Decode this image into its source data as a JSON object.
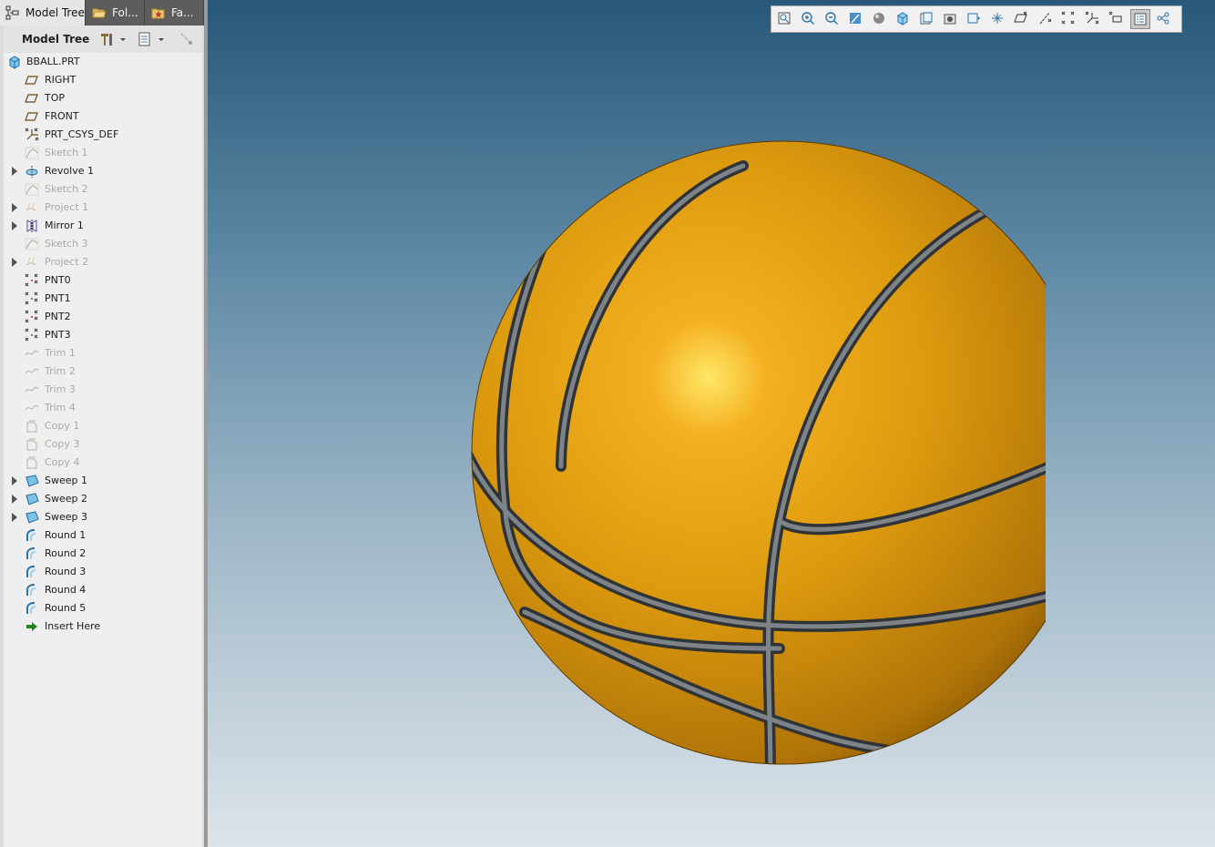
{
  "tabs": [
    {
      "label": "Model Tree",
      "icon": "model-tree-icon"
    },
    {
      "label": "Fol...",
      "icon": "folder-browser-icon"
    },
    {
      "label": "Fa...",
      "icon": "favorites-icon"
    }
  ],
  "tree_header": {
    "title": "Model Tree"
  },
  "tree": {
    "root": "BBALL.PRT",
    "items": [
      {
        "label": "RIGHT",
        "icon": "datum-plane-icon",
        "suppressed": false,
        "expandable": false
      },
      {
        "label": "TOP",
        "icon": "datum-plane-icon",
        "suppressed": false,
        "expandable": false
      },
      {
        "label": "FRONT",
        "icon": "datum-plane-icon",
        "suppressed": false,
        "expandable": false
      },
      {
        "label": "PRT_CSYS_DEF",
        "icon": "coordinate-system-icon",
        "suppressed": false,
        "expandable": false
      },
      {
        "label": "Sketch 1",
        "icon": "sketch-icon",
        "suppressed": true,
        "expandable": false
      },
      {
        "label": "Revolve 1",
        "icon": "revolve-icon",
        "suppressed": false,
        "expandable": true
      },
      {
        "label": "Sketch 2",
        "icon": "sketch-icon",
        "suppressed": true,
        "expandable": false
      },
      {
        "label": "Project 1",
        "icon": "project-icon",
        "suppressed": true,
        "expandable": true
      },
      {
        "label": "Mirror 1",
        "icon": "mirror-icon",
        "suppressed": false,
        "expandable": true
      },
      {
        "label": "Sketch 3",
        "icon": "sketch-icon",
        "suppressed": true,
        "expandable": false
      },
      {
        "label": "Project 2",
        "icon": "project-icon",
        "suppressed": true,
        "expandable": true
      },
      {
        "label": "PNT0",
        "icon": "datum-point-icon",
        "suppressed": false,
        "expandable": false
      },
      {
        "label": "PNT1",
        "icon": "datum-point-icon",
        "suppressed": false,
        "expandable": false
      },
      {
        "label": "PNT2",
        "icon": "datum-point-icon",
        "suppressed": false,
        "expandable": false
      },
      {
        "label": "PNT3",
        "icon": "datum-point-icon",
        "suppressed": false,
        "expandable": false
      },
      {
        "label": "Trim 1",
        "icon": "trim-icon",
        "suppressed": true,
        "expandable": false
      },
      {
        "label": "Trim 2",
        "icon": "trim-icon",
        "suppressed": true,
        "expandable": false
      },
      {
        "label": "Trim 3",
        "icon": "trim-icon",
        "suppressed": true,
        "expandable": false
      },
      {
        "label": "Trim 4",
        "icon": "trim-icon",
        "suppressed": true,
        "expandable": false
      },
      {
        "label": "Copy 1",
        "icon": "copy-icon",
        "suppressed": true,
        "expandable": false
      },
      {
        "label": "Copy 3",
        "icon": "copy-icon",
        "suppressed": true,
        "expandable": false
      },
      {
        "label": "Copy 4",
        "icon": "copy-icon",
        "suppressed": true,
        "expandable": false
      },
      {
        "label": "Sweep 1",
        "icon": "sweep-icon",
        "suppressed": false,
        "expandable": true
      },
      {
        "label": "Sweep 2",
        "icon": "sweep-icon",
        "suppressed": false,
        "expandable": true
      },
      {
        "label": "Sweep 3",
        "icon": "sweep-icon",
        "suppressed": false,
        "expandable": true
      },
      {
        "label": "Round 1",
        "icon": "round-icon",
        "suppressed": false,
        "expandable": false
      },
      {
        "label": "Round 2",
        "icon": "round-icon",
        "suppressed": false,
        "expandable": false
      },
      {
        "label": "Round 3",
        "icon": "round-icon",
        "suppressed": false,
        "expandable": false
      },
      {
        "label": "Round 4",
        "icon": "round-icon",
        "suppressed": false,
        "expandable": false
      },
      {
        "label": "Round 5",
        "icon": "round-icon",
        "suppressed": false,
        "expandable": false
      },
      {
        "label": "Insert Here",
        "icon": "insert-here-arrow-icon",
        "suppressed": false,
        "expandable": false
      }
    ]
  },
  "view_toolbar": [
    "refit-icon",
    "zoom-in-icon",
    "zoom-out-icon",
    "repaint-icon",
    "display-style-icon",
    "saved-orientations-icon",
    "view-manager-icon",
    "perspective-view-icon",
    "spin-center-icon",
    "annotation-display-icon",
    "plane-display-icon",
    "axis-display-icon",
    "point-display-icon",
    "csys-display-icon",
    "point-tag-display-icon",
    "model-tree-toggle-icon",
    "show-connections-icon"
  ],
  "colors": {
    "ball": "#d99a12",
    "seam": "#555a5e",
    "viewport_top": "#285878",
    "viewport_bottom": "#dde4e9"
  }
}
